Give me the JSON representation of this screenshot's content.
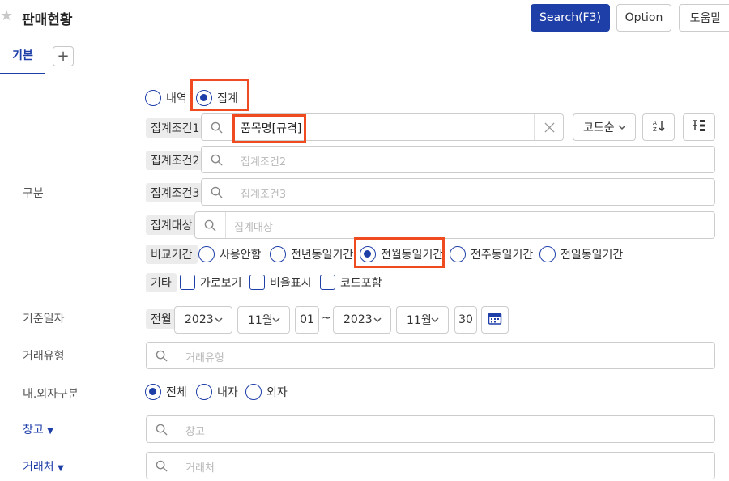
{
  "header": {
    "title": "판매현황",
    "search_label": "Search(F3)",
    "option_label": "Option",
    "help_label": "도움말"
  },
  "tabs": {
    "basic": "기본",
    "add": "+"
  },
  "section": {
    "gubun_label": "구분"
  },
  "mode": {
    "detail": "내역",
    "aggregate": "집계"
  },
  "agg": {
    "cond1_tag": "집계조건1",
    "cond1_value": "품목명[규격]",
    "cond2_tag": "집계조건2",
    "cond2_placeholder": "집계조건2",
    "cond3_tag": "집계조건3",
    "cond3_placeholder": "집계조건3",
    "target_tag": "집계대상",
    "target_placeholder": "집계대상",
    "sort_value": "코드순"
  },
  "compare": {
    "tag": "비교기간",
    "options": [
      "사용안함",
      "전년동일기간",
      "전월동일기간",
      "전주동일기간",
      "전일동일기간"
    ],
    "selected": "전월동일기간"
  },
  "etc": {
    "tag": "기타",
    "options": [
      "가로보기",
      "비율표시",
      "코드포함"
    ]
  },
  "date": {
    "label": "기준일자",
    "prefix": "전월",
    "from_year": "2023",
    "from_month": "11월",
    "from_day": "01",
    "separator": "~",
    "to_year": "2023",
    "to_month": "11월",
    "to_day": "30"
  },
  "trade_type": {
    "label": "거래유형",
    "placeholder": "거래유형"
  },
  "inout": {
    "label": "내.외자구분",
    "options": [
      "전체",
      "내자",
      "외자"
    ],
    "selected": "전체"
  },
  "warehouse": {
    "label": "창고",
    "placeholder": "창고"
  },
  "customer": {
    "label": "거래처",
    "placeholder": "거래처"
  },
  "colors": {
    "primary": "#1f3fa8",
    "highlight": "#f04a21"
  }
}
